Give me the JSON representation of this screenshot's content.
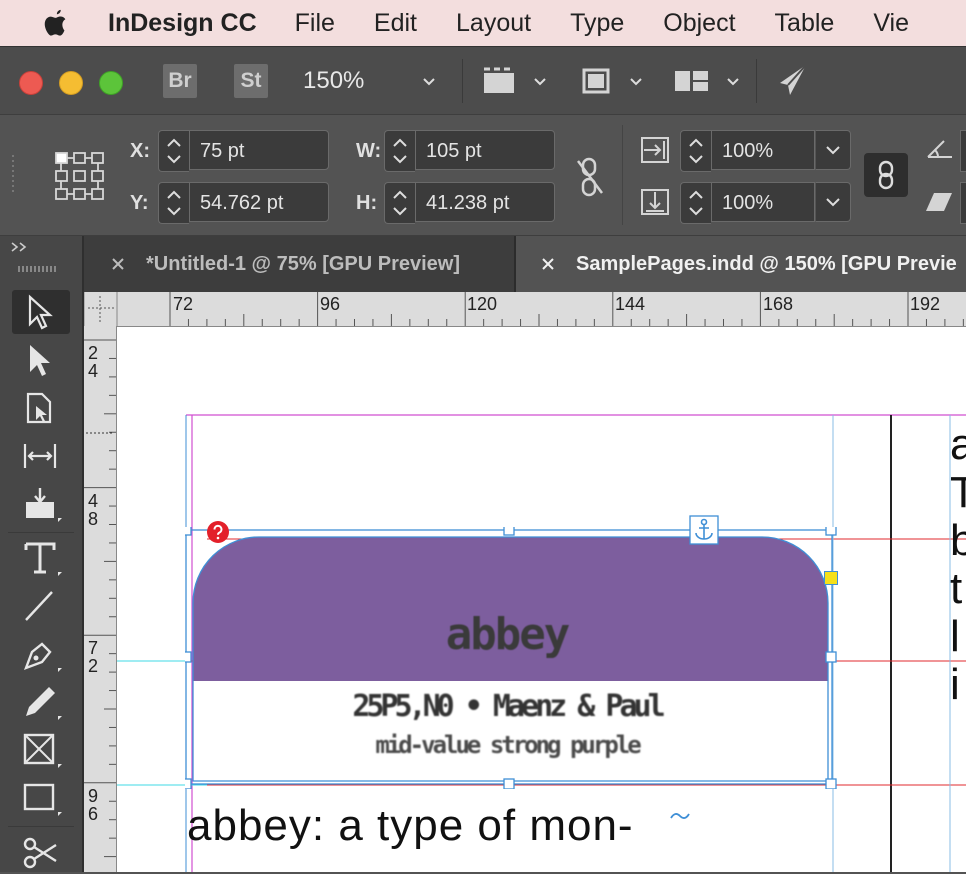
{
  "menubar": {
    "app_name": "InDesign CC",
    "items": [
      "File",
      "Edit",
      "Layout",
      "Type",
      "Object",
      "Table",
      "Vie"
    ]
  },
  "toolbar": {
    "bridge_label": "Br",
    "stock_label": "St",
    "zoom": "150%"
  },
  "control_panel": {
    "x_label": "X:",
    "x_value": "75 pt",
    "y_label": "Y:",
    "y_value": "54.762 pt",
    "w_label": "W:",
    "w_value": "105 pt",
    "h_label": "H:",
    "h_value": "41.238 pt",
    "scale_x": "100%",
    "scale_y": "100%"
  },
  "tabs": [
    {
      "label": "*Untitled-1 @ 75% [GPU Preview]",
      "active": false
    },
    {
      "label": "SamplePages.indd @ 150% [GPU Previe",
      "active": true
    }
  ],
  "ruler": {
    "h_ticks": [
      "72",
      "96",
      "120",
      "144",
      "168",
      "192"
    ],
    "v_ticks": [
      [
        "2",
        "4"
      ],
      [
        "4",
        "8"
      ],
      [
        "7",
        "2"
      ],
      [
        "9",
        "6"
      ]
    ]
  },
  "document": {
    "card_title": "abbey",
    "card_line1": "25P5,N0 • Maenz & Paul",
    "card_line2": "mid-value strong purple",
    "body_text": "abbey: a type of mon-",
    "right_column_letters": [
      "a",
      "T",
      "b",
      "t",
      "l",
      "i"
    ]
  },
  "colors": {
    "swatch_purple": "#7d5e9e",
    "frame_blue": "#3f8fd6",
    "margin_magenta": "#d04fd0",
    "guide_red": "#e0282e",
    "guide_cyan": "#3fd9e6"
  }
}
